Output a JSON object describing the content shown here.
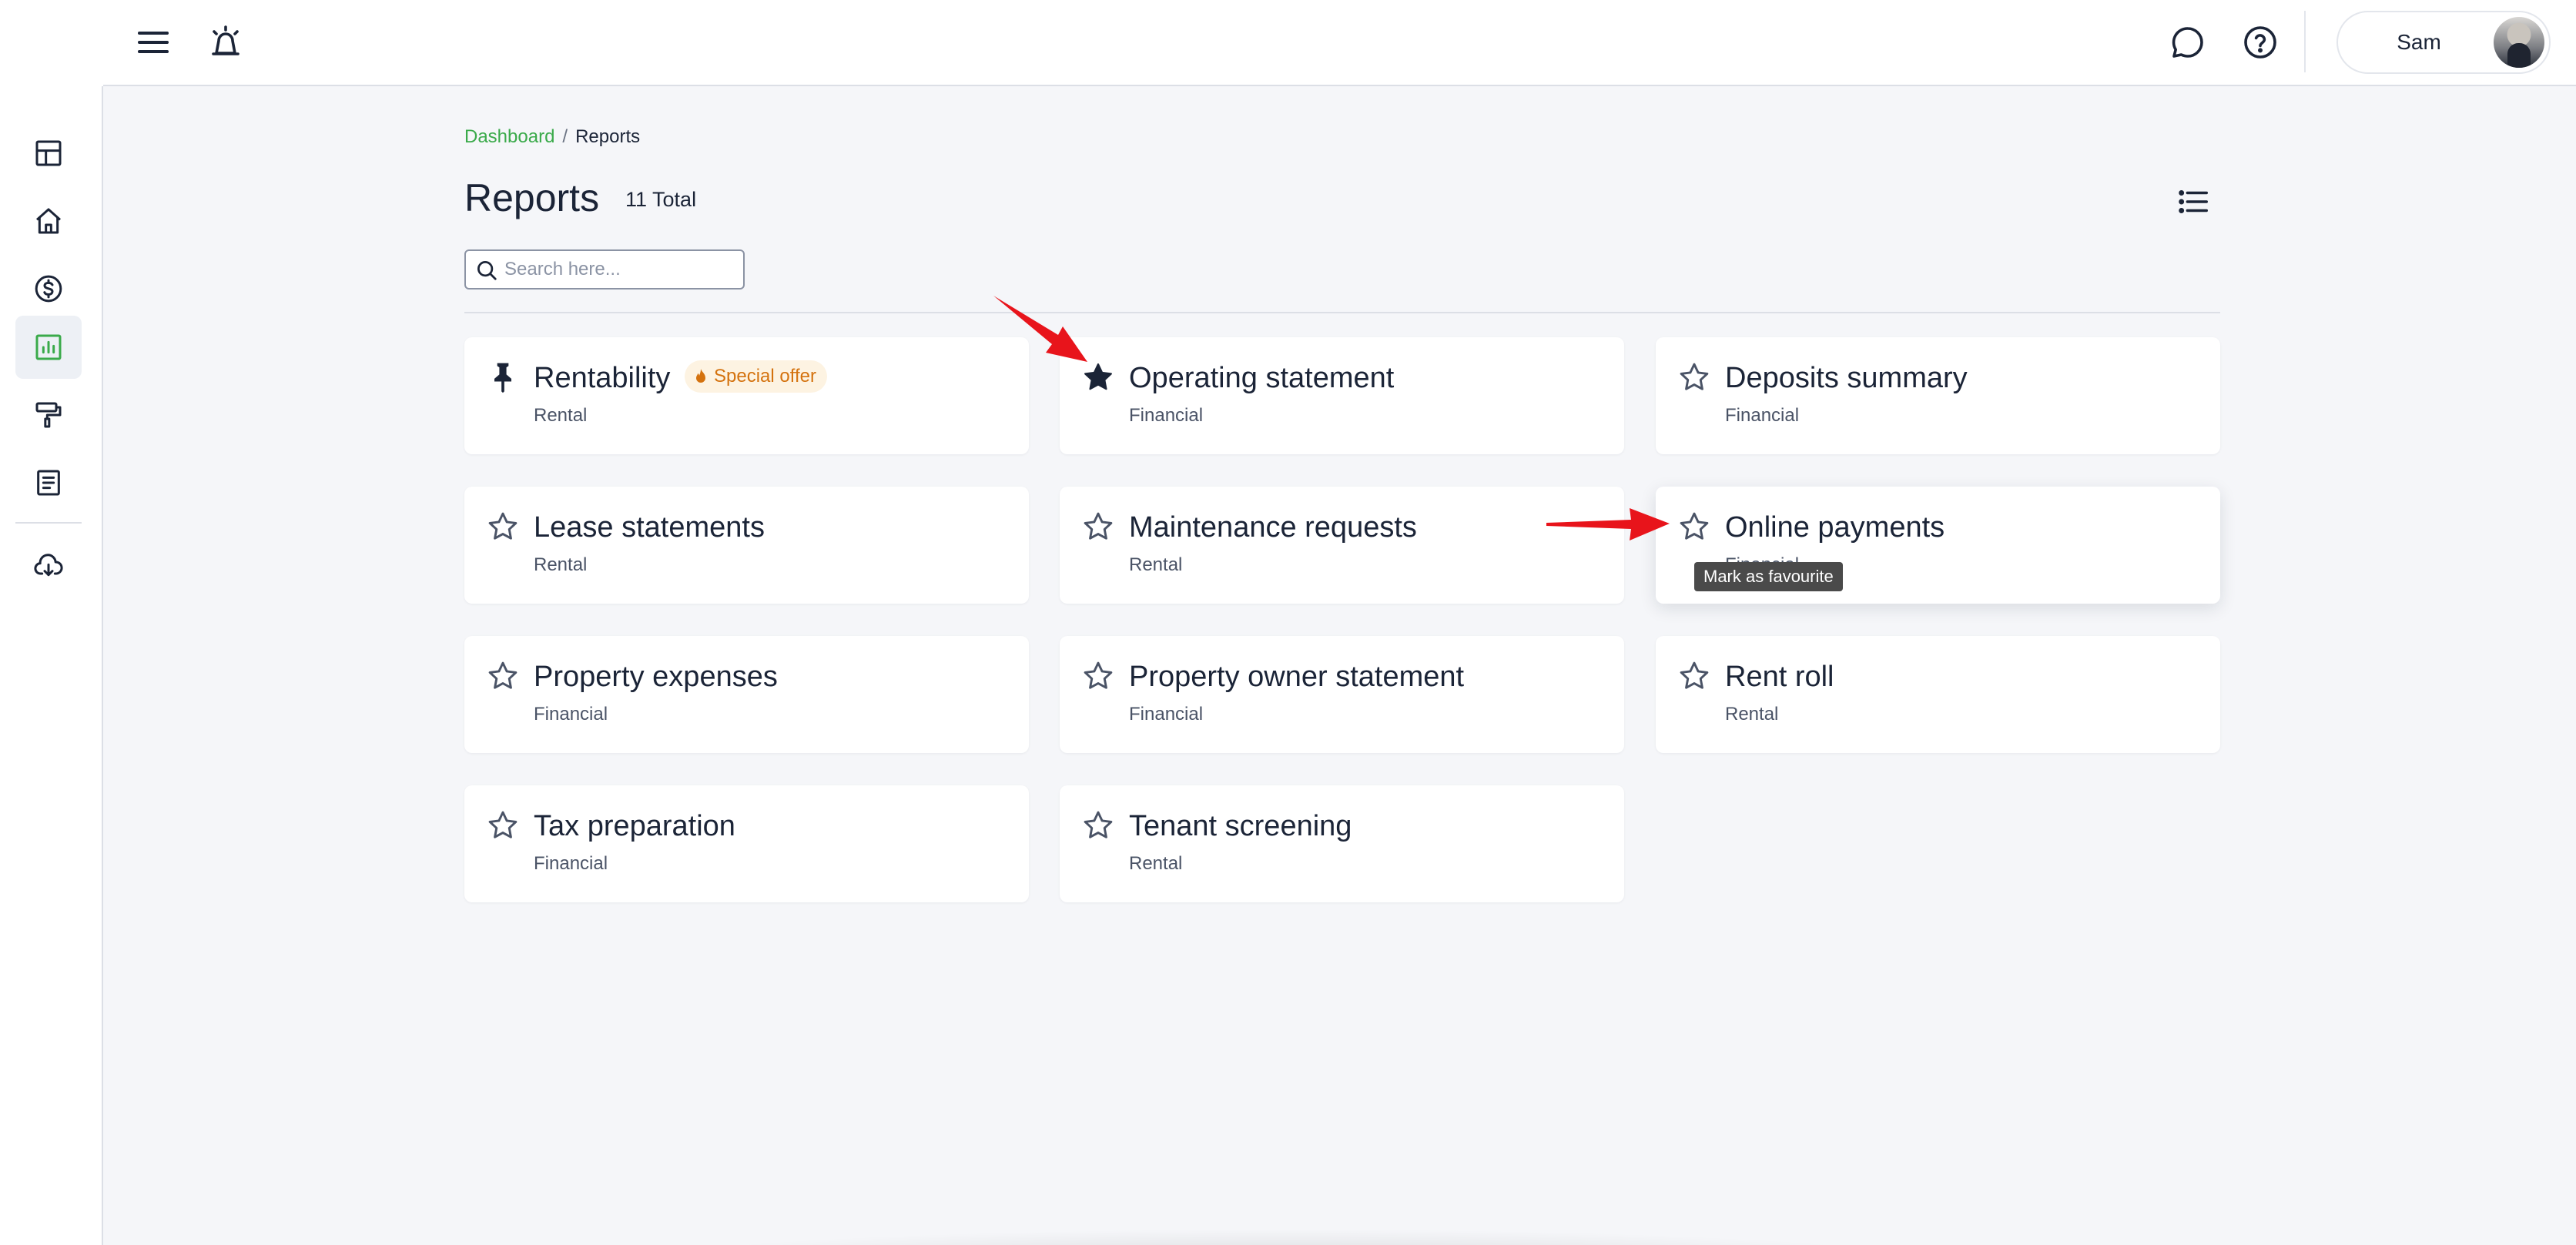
{
  "header": {
    "user_name": "Sam"
  },
  "breadcrumb": {
    "parent": "Dashboard",
    "separator": "/",
    "current": "Reports"
  },
  "page": {
    "title": "Reports",
    "total": "11 Total"
  },
  "search": {
    "placeholder": "Search here..."
  },
  "reports": [
    {
      "title": "Rentability",
      "category": "Rental",
      "icon": "pin-icon",
      "badge": "Special offer"
    },
    {
      "title": "Operating statement",
      "category": "Financial",
      "icon": "star-filled-icon"
    },
    {
      "title": "Deposits summary",
      "category": "Financial",
      "icon": "star-outline-icon"
    },
    {
      "title": "Lease statements",
      "category": "Rental",
      "icon": "star-outline-icon"
    },
    {
      "title": "Maintenance requests",
      "category": "Rental",
      "icon": "star-outline-icon"
    },
    {
      "title": "Online payments",
      "category": "Financial",
      "icon": "star-outline-icon"
    },
    {
      "title": "Property expenses",
      "category": "Financial",
      "icon": "star-outline-icon"
    },
    {
      "title": "Property owner statement",
      "category": "Financial",
      "icon": "star-outline-icon"
    },
    {
      "title": "Rent roll",
      "category": "Rental",
      "icon": "star-outline-icon"
    },
    {
      "title": "Tax preparation",
      "category": "Financial",
      "icon": "star-outline-icon"
    },
    {
      "title": "Tenant screening",
      "category": "Rental",
      "icon": "star-outline-icon"
    }
  ],
  "tooltip": "Mark as favourite",
  "colors": {
    "accent_green": "#3aaa4a",
    "text_dark": "#1b2437",
    "badge_orange": "#d4720e",
    "annotation_red": "#e8141b"
  }
}
